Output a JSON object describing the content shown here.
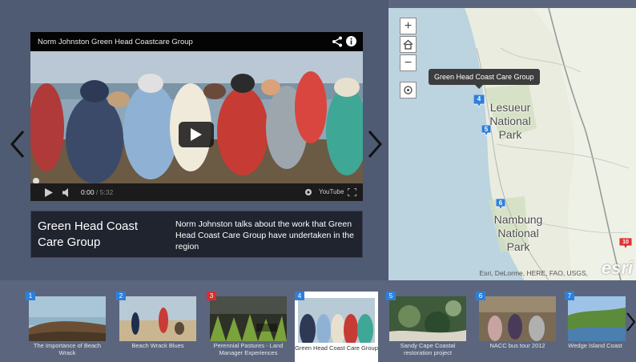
{
  "video": {
    "title": "Norm Johnston Green Head Coastcare Group",
    "current_time": "0:00",
    "total_time": "/ 5:32",
    "youtube_label": "YouTube"
  },
  "caption": {
    "title": "Green Head Coast Care Group",
    "description": "Norm Johnston talks about the work that Green Head Coast Care Group have undertaken in the region"
  },
  "map": {
    "tooltip": "Green Head Coast Care Group",
    "labels": {
      "lesueur": "Lesueur\nNational\nPark",
      "nambung": "Nambung\nNational\nPark"
    },
    "attribution": "Esri, DeLorme, HERE, FAO, USGS,",
    "logo": "esri",
    "pins": [
      {
        "num": "4",
        "color": "#2f7fd8"
      },
      {
        "num": "5",
        "color": "#2f7fd8"
      },
      {
        "num": "6",
        "color": "#2f7fd8"
      },
      {
        "num": "10",
        "color": "#d33"
      }
    ],
    "controls": {
      "zoom_in": "+",
      "zoom_out": "−"
    }
  },
  "carousel": {
    "items": [
      {
        "num": "1",
        "label": "The Importance of Beach Wrack",
        "color": "#2f7fd8"
      },
      {
        "num": "2",
        "label": "Beach Wrack Blues",
        "color": "#2f7fd8"
      },
      {
        "num": "3",
        "label": "Perennial Pastures - Land Manager Experiences",
        "color": "#d32f2f"
      },
      {
        "num": "4",
        "label": "Green Head Coast Care Group",
        "color": "#2f7fd8"
      },
      {
        "num": "5",
        "label": "Sandy Cape Coastal restoration project",
        "color": "#2f7fd8"
      },
      {
        "num": "6",
        "label": "NACC bus tour 2012",
        "color": "#2f7fd8"
      },
      {
        "num": "7",
        "label": "Wedge Island Coast",
        "color": "#2f7fd8"
      }
    ]
  }
}
